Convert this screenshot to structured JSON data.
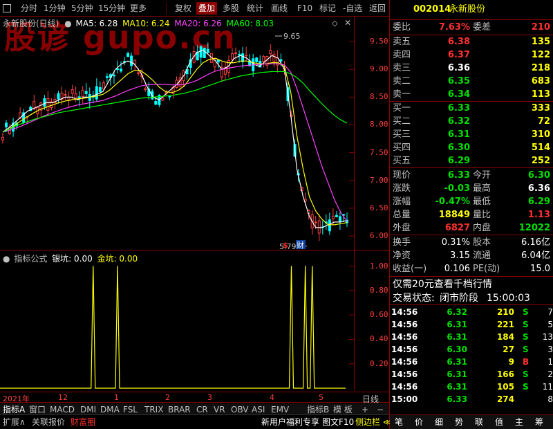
{
  "toolbar": {
    "items": [
      "分时",
      "1分钟",
      "5分钟",
      "15分钟",
      "更多",
      "复权",
      "叠加",
      "多股",
      "统计",
      "画线",
      "F10",
      "标记",
      "-自选",
      "返回"
    ],
    "active_index": 6
  },
  "watermark": "股谚 gupo.cn",
  "main_chart": {
    "title": "永新股份(日线)",
    "ma": [
      {
        "label": "MA5: 6.28",
        "color": "#ffffff"
      },
      {
        "label": "MA10: 6.24",
        "color": "#ffff00"
      },
      {
        "label": "MA20: 6.26",
        "color": "#ff40ff"
      },
      {
        "label": "MA60: 8.03",
        "color": "#00ff00"
      }
    ],
    "yticks": [
      "9.50",
      "9.00",
      "8.50",
      "8.00",
      "7.50",
      "7.00",
      "6.50",
      "6.00"
    ],
    "high_label": "9.65",
    "low_label": "5.79",
    "marker_s": "$",
    "marker_cai": "财"
  },
  "indicator": {
    "title": "指标公式",
    "vals": [
      {
        "label": "银坑: 0.00",
        "color": "#ffffff"
      },
      {
        "label": "金坑: 0.00",
        "color": "#ffff00"
      }
    ],
    "yticks": [
      "1.00",
      "0.80",
      "0.60",
      "0.40",
      "0.20"
    ]
  },
  "timeline": {
    "labels": [
      "2021年",
      "12",
      "1",
      "2",
      "3",
      "4",
      "5"
    ],
    "period": "日线"
  },
  "indicator_tabs": [
    "指标A",
    "窗口",
    "MACD",
    "DMI",
    "DMA",
    "FSL",
    "TRIX",
    "BRAR",
    "CR",
    "VR",
    "OBV",
    "ASI",
    "EMV"
  ],
  "indicator_tabs_right": [
    "指标B",
    "模 板",
    "+",
    "−"
  ],
  "bottom_tabs": [
    "扩展∧",
    "关联报价",
    "财富圈"
  ],
  "bottom_right": {
    "promo": "新用户福利专享",
    "btn1": "图文F10",
    "btn2": "侧边栏 ≪"
  },
  "right_tabs": [
    "笔",
    "价",
    "细",
    "势",
    "联",
    "值",
    "主",
    "筹"
  ],
  "quote": {
    "code": "002014",
    "name": "永新股份",
    "weibi_label": "委比",
    "weibi": "7.63%",
    "weicha_label": "委差",
    "weicha": "210",
    "asks": [
      {
        "label": "卖五",
        "price": "6.38",
        "vol": "135",
        "pc": "red"
      },
      {
        "label": "卖四",
        "price": "6.37",
        "vol": "122",
        "pc": "red"
      },
      {
        "label": "卖三",
        "price": "6.36",
        "vol": "218",
        "pc": "white"
      },
      {
        "label": "卖二",
        "price": "6.35",
        "vol": "683",
        "pc": "green"
      },
      {
        "label": "卖一",
        "price": "6.34",
        "vol": "113",
        "pc": "green"
      }
    ],
    "bids": [
      {
        "label": "买一",
        "price": "6.33",
        "vol": "333",
        "pc": "green"
      },
      {
        "label": "买二",
        "price": "6.32",
        "vol": "72",
        "pc": "green"
      },
      {
        "label": "买三",
        "price": "6.31",
        "vol": "310",
        "pc": "green"
      },
      {
        "label": "买四",
        "price": "6.30",
        "vol": "514",
        "pc": "green"
      },
      {
        "label": "买五",
        "price": "6.29",
        "vol": "252",
        "pc": "green"
      }
    ],
    "stats": [
      {
        "l1": "现价",
        "v1": "6.33",
        "c1": "green",
        "l2": "今开",
        "v2": "6.30",
        "c2": "green"
      },
      {
        "l1": "涨跌",
        "v1": "-0.03",
        "c1": "green",
        "l2": "最高",
        "v2": "6.36",
        "c2": "white"
      },
      {
        "l1": "涨幅",
        "v1": "-0.47%",
        "c1": "green",
        "l2": "最低",
        "v2": "6.29",
        "c2": "green"
      },
      {
        "l1": "总量",
        "v1": "18849",
        "c1": "yellow",
        "l2": "量比",
        "v2": "1.13",
        "c2": "red"
      },
      {
        "l1": "外盘",
        "v1": "6827",
        "c1": "red",
        "l2": "内盘",
        "v2": "12022",
        "c2": "green"
      }
    ],
    "fin": [
      {
        "l1": "换手",
        "v1": "0.31%",
        "l2": "股本",
        "v2": "6.16亿"
      },
      {
        "l1": "净资",
        "v1": "3.15",
        "l2": "流通",
        "v2": "6.04亿"
      },
      {
        "l1": "收益(一)",
        "v1": "0.106",
        "l2": "PE(动)",
        "v2": "15.0"
      }
    ],
    "promo": "仅需20元查看千档行情",
    "status_label": "交易状态:",
    "status": "闭市阶段",
    "status_time": "15:00:03"
  },
  "ticks": [
    {
      "time": "14:56",
      "price": "6.32",
      "vol": "210",
      "bs": "S",
      "n": "7",
      "pc": "green",
      "bc": "green"
    },
    {
      "time": "14:56",
      "price": "6.31",
      "vol": "221",
      "bs": "S",
      "n": "5",
      "pc": "green",
      "bc": "green"
    },
    {
      "time": "14:56",
      "price": "6.31",
      "vol": "184",
      "bs": "S",
      "n": "13",
      "pc": "green",
      "bc": "green"
    },
    {
      "time": "14:56",
      "price": "6.30",
      "vol": "27",
      "bs": "S",
      "n": "3",
      "pc": "green",
      "bc": "green"
    },
    {
      "time": "14:56",
      "price": "6.31",
      "vol": "9",
      "bs": "B",
      "n": "1",
      "pc": "green",
      "bc": "red"
    },
    {
      "time": "14:56",
      "price": "6.31",
      "vol": "166",
      "bs": "S",
      "n": "2",
      "pc": "green",
      "bc": "green"
    },
    {
      "time": "14:56",
      "price": "6.31",
      "vol": "105",
      "bs": "S",
      "n": "11",
      "pc": "green",
      "bc": "green"
    },
    {
      "time": "15:00",
      "price": "6.33",
      "vol": "274",
      "bs": "",
      "n": "8",
      "pc": "green",
      "bc": "white"
    }
  ],
  "chart_data": [
    {
      "type": "line",
      "title": "永新股份(日线)",
      "ylim": [
        5.75,
        9.95
      ],
      "series": [
        {
          "name": "MA5",
          "color": "#ffffff",
          "values": [
            7.87,
            7.95,
            8.05,
            8.15,
            8.25,
            8.3,
            8.35,
            8.4,
            8.4,
            8.45,
            8.5,
            8.5,
            8.45,
            8.5,
            8.5,
            8.55,
            8.6,
            8.8,
            9.0,
            9.1,
            9.15,
            9.1,
            8.95,
            8.7,
            8.5,
            8.45,
            8.55,
            8.65,
            8.75,
            8.9,
            9.15,
            9.3,
            9.35,
            9.25,
            9.15,
            9.0,
            9.05,
            9.2,
            9.25,
            9.2,
            9.1,
            9.05,
            9.15,
            9.25,
            9.2,
            9.0,
            8.2,
            7.2,
            6.7,
            6.35,
            6.15,
            6.15,
            6.2,
            6.25,
            6.25,
            6.28
          ]
        },
        {
          "name": "MA10",
          "color": "#ffff00",
          "values": [
            7.87,
            7.92,
            8.0,
            8.08,
            8.15,
            8.22,
            8.28,
            8.32,
            8.36,
            8.4,
            8.43,
            8.45,
            8.47,
            8.48,
            8.5,
            8.52,
            8.55,
            8.62,
            8.72,
            8.82,
            8.92,
            8.98,
            8.98,
            8.9,
            8.8,
            8.68,
            8.6,
            8.58,
            8.62,
            8.7,
            8.85,
            9.0,
            9.12,
            9.18,
            9.2,
            9.15,
            9.12,
            9.12,
            9.15,
            9.15,
            9.12,
            9.1,
            9.1,
            9.12,
            9.12,
            9.05,
            8.6,
            7.8,
            7.2,
            6.7,
            6.45,
            6.3,
            6.2,
            6.2,
            6.22,
            6.24
          ]
        },
        {
          "name": "MA20",
          "color": "#ff40ff",
          "values": [
            7.87,
            7.9,
            7.94,
            7.98,
            8.03,
            8.08,
            8.13,
            8.18,
            8.22,
            8.26,
            8.3,
            8.33,
            8.36,
            8.38,
            8.4,
            8.42,
            8.44,
            8.48,
            8.52,
            8.57,
            8.62,
            8.66,
            8.7,
            8.72,
            8.73,
            8.73,
            8.73,
            8.72,
            8.72,
            8.73,
            8.76,
            8.8,
            8.86,
            8.92,
            8.97,
            9.0,
            9.02,
            9.04,
            9.06,
            9.07,
            9.08,
            9.09,
            9.1,
            9.1,
            9.1,
            9.08,
            8.95,
            8.65,
            8.3,
            7.95,
            7.6,
            7.25,
            6.95,
            6.65,
            6.42,
            6.26
          ]
        },
        {
          "name": "MA60",
          "color": "#00ff00",
          "values": [
            7.87,
            7.92,
            7.98,
            8.02,
            8.06,
            8.1,
            8.13,
            8.16,
            8.19,
            8.22,
            8.24,
            8.26,
            8.28,
            8.3,
            8.32,
            8.34,
            8.36,
            8.38,
            8.4,
            8.42,
            8.44,
            8.46,
            8.48,
            8.49,
            8.5,
            8.51,
            8.52,
            8.53,
            8.55,
            8.57,
            8.6,
            8.63,
            8.67,
            8.71,
            8.75,
            8.79,
            8.82,
            8.85,
            8.88,
            8.9,
            8.92,
            8.94,
            8.95,
            8.96,
            8.96,
            8.96,
            8.92,
            8.85,
            8.75,
            8.62,
            8.5,
            8.38,
            8.27,
            8.17,
            8.09,
            8.03
          ]
        }
      ],
      "annotations": [
        {
          "label": "9.65",
          "value": 9.65
        },
        {
          "label": "5.79",
          "value": 5.79
        }
      ]
    },
    {
      "type": "line",
      "title": "指标公式",
      "ylim": [
        0,
        1.1
      ],
      "series": [
        {
          "name": "金坑",
          "color": "#ffff00",
          "spikes": [
            {
              "index": 26,
              "value": 1
            },
            {
              "index": 33,
              "value": 1
            },
            {
              "index": 83,
              "value": 1
            },
            {
              "index": 87,
              "value": 1
            },
            {
              "index": 89,
              "value": 1
            }
          ]
        }
      ]
    }
  ]
}
